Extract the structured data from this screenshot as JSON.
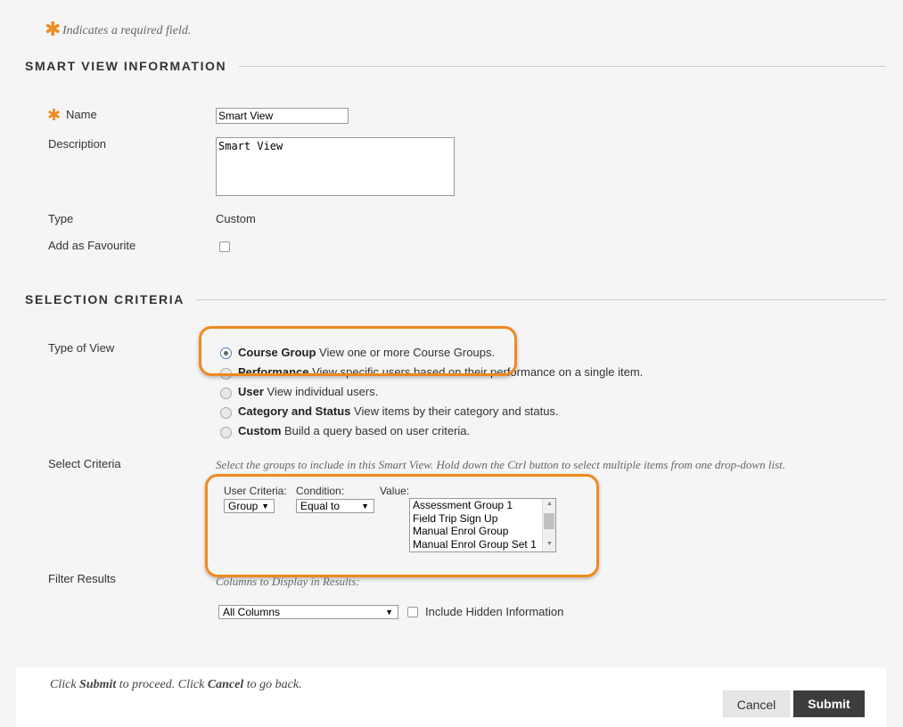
{
  "required_note": "Indicates a required field.",
  "required_star": "✱",
  "smart_view_section": {
    "title": "SMART VIEW INFORMATION",
    "name_label": "Name",
    "name_value": "Smart View",
    "description_label": "Description",
    "description_value": "Smart View",
    "type_label": "Type",
    "type_value": "Custom",
    "favourite_label": "Add as Favourite"
  },
  "selection_section": {
    "title": "SELECTION CRITERIA",
    "type_of_view_label": "Type of View",
    "view_options": [
      {
        "name": "Course Group",
        "desc": "View one or more Course Groups.",
        "selected": true
      },
      {
        "name": "Performance",
        "desc": "View specific users based on their performance on a single item.",
        "selected": false
      },
      {
        "name": "User",
        "desc": "View individual users.",
        "selected": false
      },
      {
        "name": "Category and Status",
        "desc": "View items by their category and status.",
        "selected": false
      },
      {
        "name": "Custom",
        "desc": "Build a query based on user criteria.",
        "selected": false
      }
    ],
    "select_criteria_label": "Select Criteria",
    "select_criteria_hint": "Select the groups to include in this Smart View. Hold down the Ctrl button to select multiple items from one drop-down list.",
    "user_criteria_label": "User Criteria:",
    "user_criteria_value": "Group",
    "condition_label": "Condition:",
    "condition_value": "Equal to",
    "value_label": "Value:",
    "value_options": [
      "Assessment Group 1",
      "Field Trip Sign Up",
      "Manual Enrol Group",
      "Manual Enrol Group Set 1"
    ],
    "filter_results_label": "Filter Results",
    "columns_label": "Columns to Display in Results:",
    "columns_value": "All Columns",
    "include_hidden_label": "Include Hidden Information"
  },
  "footer": {
    "instruction_click1": "Click ",
    "instruction_submit": "Submit",
    "instruction_mid": " to proceed. Click ",
    "instruction_cancel": "Cancel",
    "instruction_end": " to go back.",
    "cancel_button": "Cancel",
    "submit_button": "Submit"
  },
  "colors": {
    "accent_orange": "#f0891f",
    "submit_bg": "#3d3d3d",
    "cancel_bg": "#e6e6e6"
  },
  "icons": {
    "dropdown": "▼"
  }
}
